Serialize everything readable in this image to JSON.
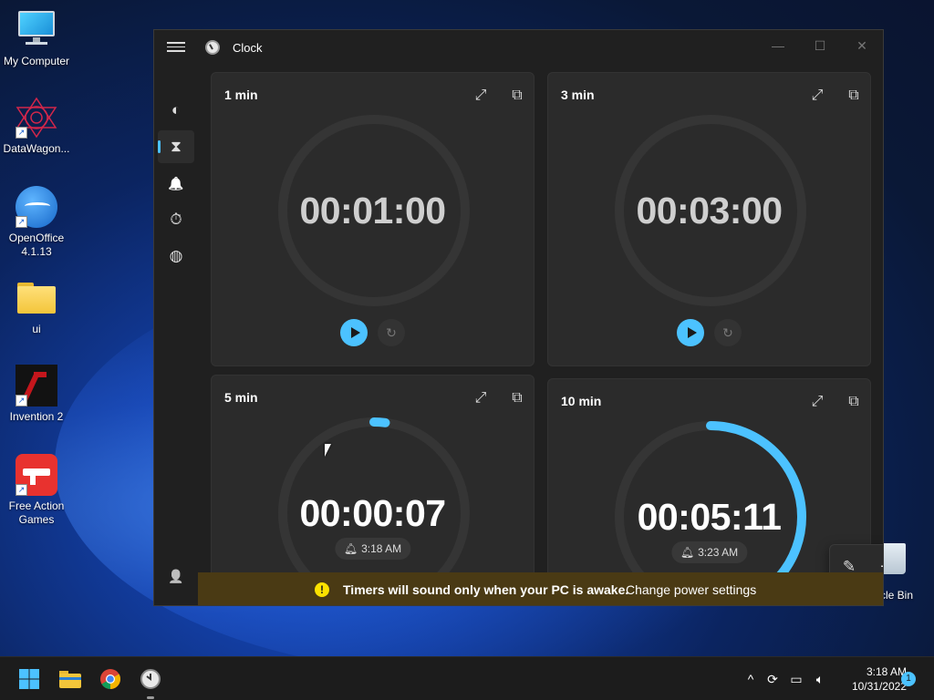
{
  "desktop": {
    "icons": [
      {
        "label": "My Computer"
      },
      {
        "label": "DataWagon..."
      },
      {
        "label": "OpenOffice 4.1.13"
      },
      {
        "label": "ui"
      },
      {
        "label": "Invention 2"
      },
      {
        "label": "Free Action Games"
      }
    ],
    "recycle_bin_label": "cycle Bin"
  },
  "window": {
    "title": "Clock",
    "controls": {
      "minimize": "—",
      "maximize": "☐",
      "close": "✕"
    }
  },
  "nav": {
    "items": [
      {
        "name": "focus-sessions",
        "icon": "focus-icon",
        "glyph": "◐"
      },
      {
        "name": "timer",
        "icon": "hourglass-icon",
        "glyph": "⧗",
        "active": true
      },
      {
        "name": "alarm",
        "icon": "bell-icon",
        "glyph": "🔔"
      },
      {
        "name": "stopwatch",
        "icon": "stopwatch-icon",
        "glyph": "⏱"
      },
      {
        "name": "world-clock",
        "icon": "globe-icon",
        "glyph": "◍"
      }
    ],
    "account_glyph": "👤",
    "settings_glyph": "⚙"
  },
  "timers": [
    {
      "label": "1 min",
      "time": "00:01:00",
      "running": false,
      "progress": 0
    },
    {
      "label": "3 min",
      "time": "00:03:00",
      "running": false,
      "progress": 0
    },
    {
      "label": "5 min",
      "time": "00:00:07",
      "running": true,
      "end_time": "3:18 AM",
      "progress": 0.02
    },
    {
      "label": "10 min",
      "time": "00:05:11",
      "running": true,
      "end_time": "3:23 AM",
      "progress": 0.48
    }
  ],
  "fab": {
    "edit_glyph": "✎",
    "add_glyph": "+"
  },
  "banner": {
    "warning_glyph": "!",
    "message": "Timers will sound only when your PC is awake.",
    "link": "Change power settings"
  },
  "taskbar": {
    "clock_time": "3:18 AM",
    "clock_date": "10/31/2022",
    "notification_count": "1"
  },
  "colors": {
    "accent": "#4cc2ff",
    "warning": "#fce100",
    "banner_bg": "#4a3a14"
  }
}
